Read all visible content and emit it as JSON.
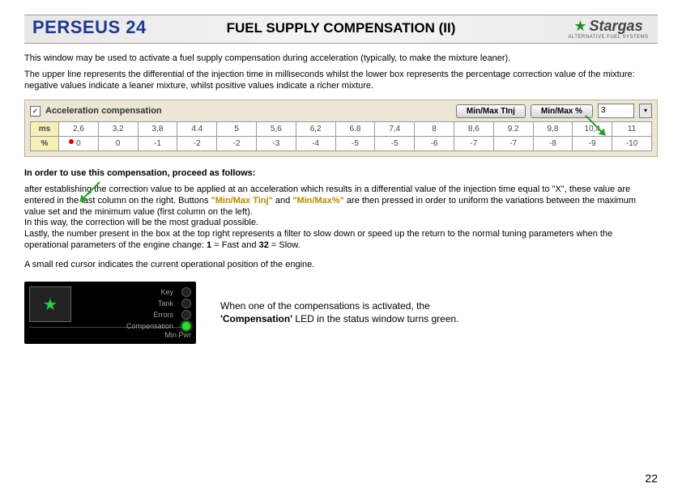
{
  "header": {
    "brand": "PERSEUS 24",
    "title": "FUEL SUPPLY COMPENSATION (II)",
    "logo_text": "Stargas",
    "logo_sub": "ALTERNATIVE FUEL SYSTEMS"
  },
  "paragraphs": {
    "p1": "This window may be used to activate a fuel supply compensation during acceleration (typically, to make the mixture leaner).",
    "p2": "The upper line represents the differential of the injection time in milliseconds whilst the lower box represents the percentage correction value of the mixture: negative values indicate a leaner mixture, whilst positive values indicate a richer mixture."
  },
  "tabletop": {
    "checkbox_checked": true,
    "checkbox_label": "Acceleration compensation",
    "btn1": "Min/Max TInj",
    "btn2": "Min/Max %",
    "filter_value": "3"
  },
  "table": {
    "row_ms_label": "ms",
    "row_pct_label": "%",
    "ms": [
      "2,6",
      "3,2",
      "3,8",
      "4.4",
      "5",
      "5,6",
      "6,2",
      "6.8",
      "7,4",
      "8",
      "8,6",
      "9.2",
      "9,8",
      "10,4",
      "11"
    ],
    "pct": [
      "0",
      "0",
      "-1",
      "-2",
      "-2",
      "-3",
      "-4",
      "-5",
      "-5",
      "-6",
      "-7",
      "-7",
      "-8",
      "-9",
      "-10"
    ]
  },
  "proc": {
    "lead": "In order to use this compensation, proceed as follows:",
    "body_a": "after establishing the correction value to be applied at an acceleration which results in a differential value of the injection time equal to \"X\", these value are entered in the last column on the right. Buttons ",
    "body_b": " and ",
    "body_c": " are then pressed in order to uniform the variations between the maximum value set and the minimum value (first column on the left).",
    "body_d": "In this way, the correction will be the most gradual possible.",
    "body_e": "Lastly, the number present in the box at the top right represents a filter to slow down or speed up the return to the normal tuning parameters when the operational parameters of the engine change: ",
    "body_f1": "1",
    "body_f1t": "= Fast and ",
    "body_f2": "32",
    "body_f2t": "= Slow.",
    "hl1": "\"Min/Max Tinj\"",
    "hl2": "\"Min/Max%\""
  },
  "cursor_note": "A small red cursor indicates the current operational position of the engine.",
  "panel": {
    "led_labels": [
      "Key",
      "Tank",
      "Errors",
      "Compensation"
    ],
    "led_on_index": 3,
    "minpwr": "Min Pwr"
  },
  "side_note_a": "When one of the compensations is activated, the ",
  "side_note_b": "'Compensation'",
  "side_note_c": " LED in the status window turns green.",
  "page_number": "22"
}
